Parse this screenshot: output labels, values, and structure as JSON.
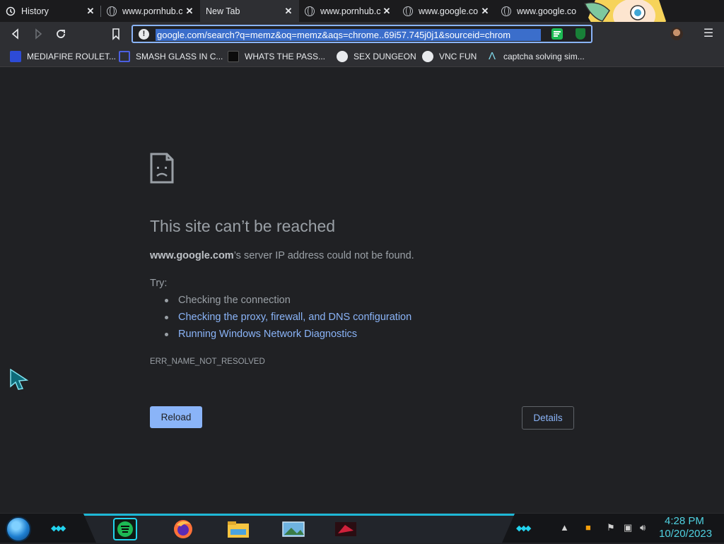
{
  "tabs": [
    {
      "label": "History",
      "icon": "history-icon",
      "active": false
    },
    {
      "label": "www.pornhub.c",
      "icon": "globe-icon",
      "active": false
    },
    {
      "label": "New Tab",
      "icon": "none",
      "active": true
    },
    {
      "label": "www.pornhub.c",
      "icon": "globe-icon",
      "active": false
    },
    {
      "label": "www.google.co",
      "icon": "globe-icon",
      "active": false
    },
    {
      "label": "www.google.co",
      "icon": "globe-icon",
      "active": false
    }
  ],
  "toolbar": {
    "url": "google.com/search?q=memz&oq=memz&aqs=chrome..69i57.745j0j1&sourceid=chrom"
  },
  "bookmarks": [
    {
      "label": "MEDIAFIRE ROULET...",
      "icon": "mediafire-icon"
    },
    {
      "label": "SMASH GLASS IN C...",
      "icon": "sigma-icon"
    },
    {
      "label": "WHATS THE PASS...",
      "icon": "dark-square-icon"
    },
    {
      "label": "SEX DUNGEON",
      "icon": "steam-icon"
    },
    {
      "label": "VNC FUN",
      "icon": "steam-icon"
    },
    {
      "label": "captcha solving sim...",
      "icon": "lambda-icon"
    }
  ],
  "error": {
    "title": "This site can’t be reached",
    "host": "www.google.com",
    "message": "’s server IP address could not be found.",
    "try_label": "Try:",
    "suggestions": [
      {
        "text": "Checking the connection",
        "link": false
      },
      {
        "text": "Checking the proxy, firewall, and DNS configuration",
        "link": true
      },
      {
        "text": "Running Windows Network Diagnostics",
        "link": true
      }
    ],
    "code": "ERR_NAME_NOT_RESOLVED",
    "reload_label": "Reload",
    "details_label": "Details"
  },
  "taskbar": {
    "time": "4:28 PM",
    "date": "10/20/2023",
    "apps": [
      "spotify-icon",
      "firefox-icon",
      "file-explorer-icon",
      "photos-icon",
      "game-icon"
    ]
  },
  "colors": {
    "accent": "#8ab4f8",
    "background": "#202124",
    "taskbar_accent": "#22d3ee"
  }
}
